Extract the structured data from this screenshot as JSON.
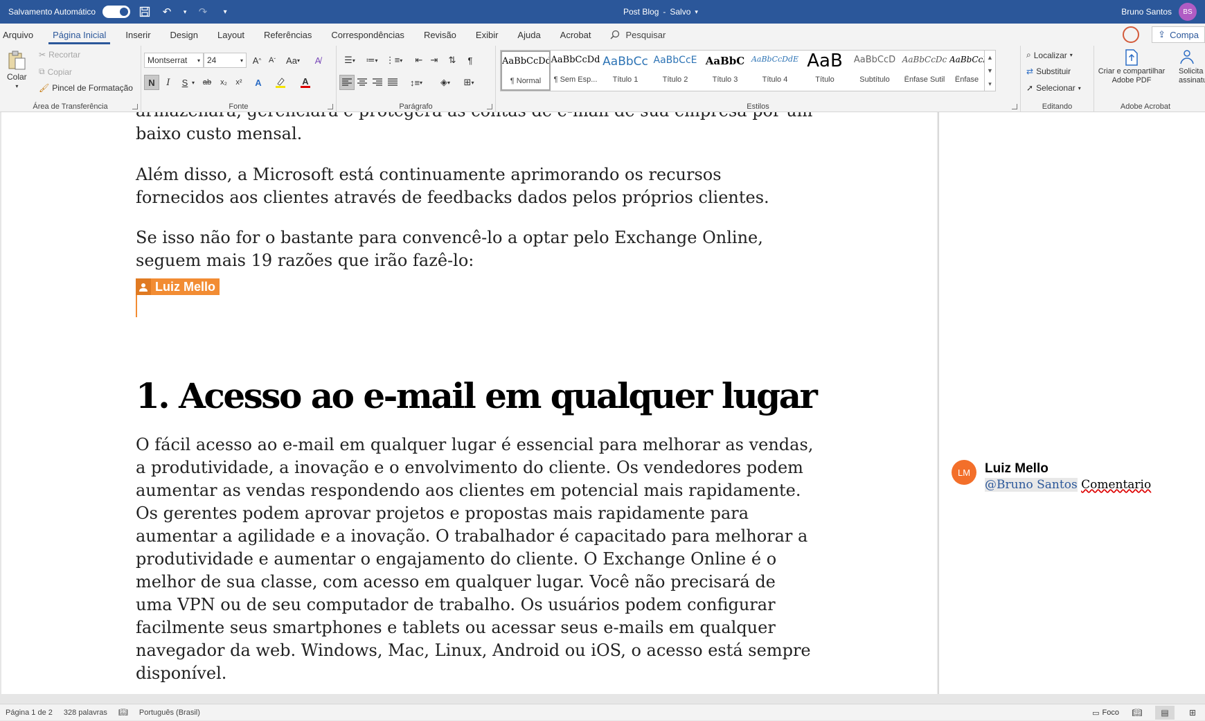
{
  "titlebar": {
    "autosave_label": "Salvamento Automático",
    "doc_title": "Post Blog",
    "separator": "-",
    "save_state": "Salvo",
    "user_name": "Bruno Santos",
    "user_initials": "BS"
  },
  "menu": {
    "items": [
      "Arquivo",
      "Página Inicial",
      "Inserir",
      "Design",
      "Layout",
      "Referências",
      "Correspondências",
      "Revisão",
      "Exibir",
      "Ajuda",
      "Acrobat"
    ],
    "search_label": "Pesquisar",
    "share_label": "Compa"
  },
  "clipboard": {
    "paste": "Colar",
    "cut": "Recortar",
    "copy": "Copiar",
    "format_painter": "Pincel de Formatação",
    "label": "Área de Transferência"
  },
  "font": {
    "family": "Montserrat",
    "size": "24",
    "bold": "N",
    "italic": "I",
    "underline": "S",
    "strike": "ab",
    "sub": "x₂",
    "sup": "x²",
    "case": "Aa",
    "grow": "A",
    "shrink": "A",
    "label": "Fonte"
  },
  "paragraph": {
    "label": "Parágrafo"
  },
  "styles": {
    "label": "Estilos",
    "items": [
      {
        "preview": "AaBbCcDd",
        "name": "¶ Normal"
      },
      {
        "preview": "AaBbCcDd",
        "name": "¶ Sem Esp..."
      },
      {
        "preview": "AaBbCc",
        "name": "Título 1"
      },
      {
        "preview": "AaBbCcE",
        "name": "Título 2"
      },
      {
        "preview": "AaBbC",
        "name": "Título 3"
      },
      {
        "preview": "AaBbCcDdE",
        "name": "Título 4"
      },
      {
        "preview": "AaB",
        "name": "Título"
      },
      {
        "preview": "AaBbCcD",
        "name": "Subtítulo"
      },
      {
        "preview": "AaBbCcDc",
        "name": "Ênfase Sutil"
      },
      {
        "preview": "AaBbCcDc",
        "name": "Ênfase"
      }
    ]
  },
  "editing": {
    "find": "Localizar",
    "replace": "Substituir",
    "select": "Selecionar",
    "label": "Editando"
  },
  "acrobat": {
    "create_share": "Criar e compartilhar",
    "create_share_2": "Adobe PDF",
    "request": "Solicita",
    "request_2": "assinatu",
    "label": "Adobe Acrobat"
  },
  "document": {
    "partial_line": "armazenará, gerenciará e protegerá as contas de e-mail de sua empresa por um",
    "partial_line_2": "baixo custo mensal.",
    "para2": "Além disso, a Microsoft está continuamente aprimorando os recursos fornecidos aos clientes através de feedbacks dados pelos próprios clientes.",
    "para3": "Se isso não for o bastante para convencê-lo a optar pelo Exchange Online, seguem mais 19 razões que irão fazê-lo:",
    "coauthor_flag": "Luiz Mello",
    "heading": "1. Acesso ao e-mail em qualquer lugar",
    "body": "O fácil acesso ao e-mail em qualquer lugar é essencial para melhorar as vendas, a produtividade, a inovação e o envolvimento do cliente. Os vendedores podem aumentar as vendas respondendo aos clientes em potencial mais rapidamente. Os gerentes podem aprovar projetos e propostas mais rapidamente para aumentar a agilidade e a inovação. O trabalhador é capacitado para melhorar a produtividade e aumentar o engajamento do cliente. O Exchange Online é o melhor de sua classe, com acesso em qualquer lugar. Você não precisará de uma VPN ou de seu computador de trabalho. Os usuários podem configurar facilmente seus smartphones e tablets ou acessar seus e-mails em qualquer navegador da web. Windows, Mac, Linux, Android ou iOS, o acesso está sempre disponível."
  },
  "comment": {
    "initials": "LM",
    "author": "Luiz Mello",
    "mention": "@Bruno Santos",
    "text": "Comentario"
  },
  "status": {
    "page": "Página 1 de 2",
    "words": "328 palavras",
    "language": "Português (Brasil)",
    "focus": "Foco"
  },
  "colors": {
    "titlebar": "#2b579a",
    "coauthor": "#f28c33",
    "comment_avatar": "#f36f2a",
    "user_avatar": "#b05cc4"
  }
}
